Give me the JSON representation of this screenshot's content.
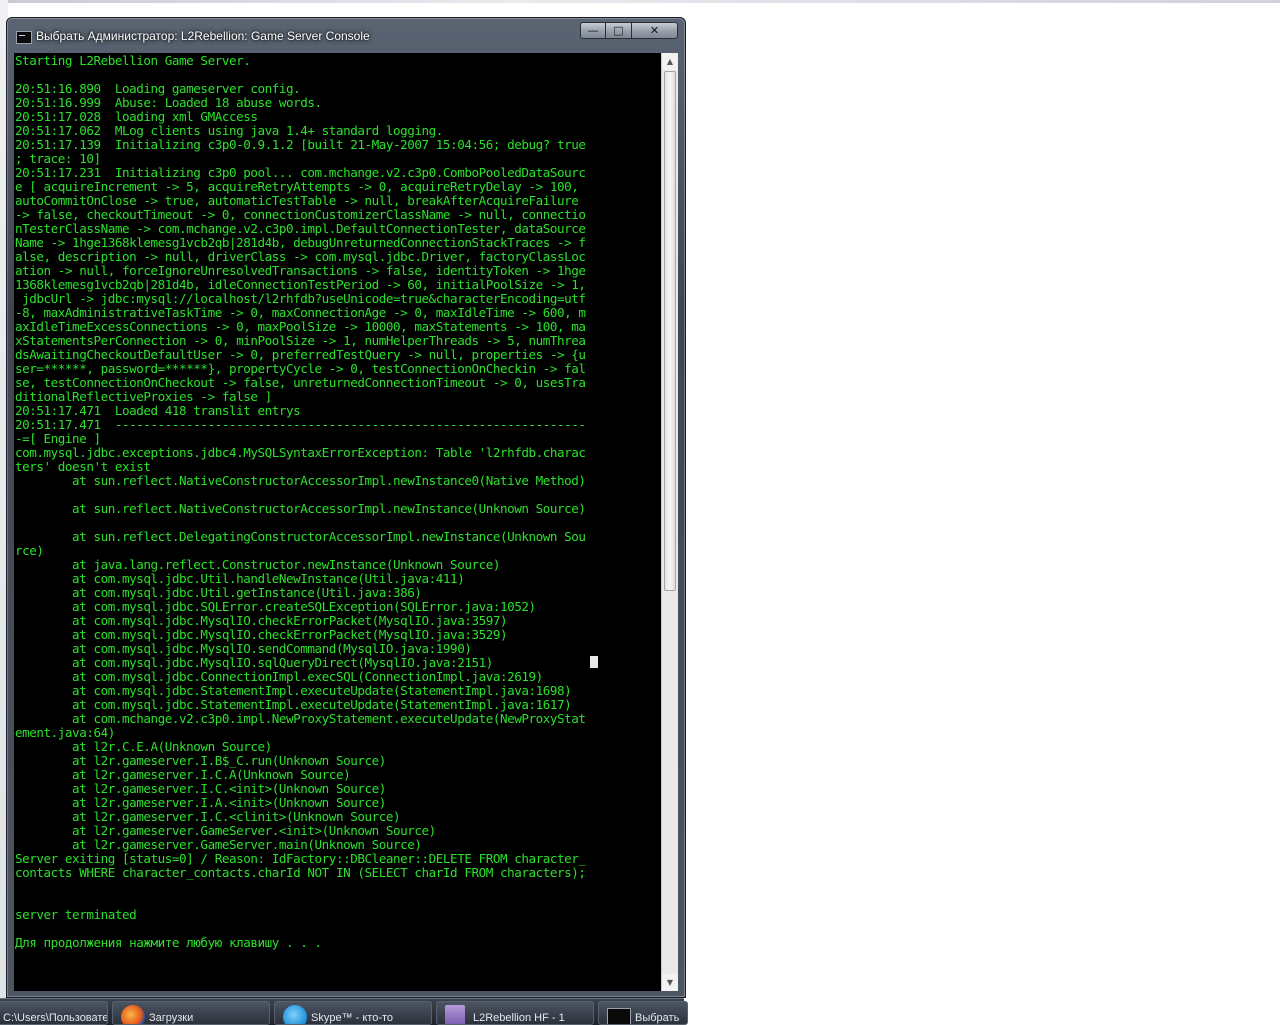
{
  "window": {
    "title": "Выбрать Администратор:  L2Rebellion: Game Server Console",
    "buttons": {
      "minimize": "—",
      "maximize": "□",
      "close": "✕"
    }
  },
  "console": {
    "lines": [
      "Starting L2Rebellion Game Server.",
      "",
      "20:51:16.890  Loading gameserver config.",
      "20:51:16.999  Abuse: Loaded 18 abuse words.",
      "20:51:17.028  loading xml GMAccess",
      "20:51:17.062  MLog clients using java 1.4+ standard logging.",
      "20:51:17.139  Initializing c3p0-0.9.1.2 [built 21-May-2007 15:04:56; debug? true",
      "; trace: 10]",
      "20:51:17.231  Initializing c3p0 pool... com.mchange.v2.c3p0.ComboPooledDataSourc",
      "e [ acquireIncrement -> 5, acquireRetryAttempts -> 0, acquireRetryDelay -> 100,",
      "autoCommitOnClose -> true, automaticTestTable -> null, breakAfterAcquireFailure",
      "-> false, checkoutTimeout -> 0, connectionCustomizerClassName -> null, connectio",
      "nTesterClassName -> com.mchange.v2.c3p0.impl.DefaultConnectionTester, dataSource",
      "Name -> 1hge1368klemesg1vcb2qb|281d4b, debugUnreturnedConnectionStackTraces -> f",
      "alse, description -> null, driverClass -> com.mysql.jdbc.Driver, factoryClassLoc",
      "ation -> null, forceIgnoreUnresolvedTransactions -> false, identityToken -> 1hge",
      "1368klemesg1vcb2qb|281d4b, idleConnectionTestPeriod -> 60, initialPoolSize -> 1,",
      " jdbcUrl -> jdbc:mysql://localhost/l2rhfdb?useUnicode=true&characterEncoding=utf",
      "-8, maxAdministrativeTaskTime -> 0, maxConnectionAge -> 0, maxIdleTime -> 600, m",
      "axIdleTimeExcessConnections -> 0, maxPoolSize -> 10000, maxStatements -> 100, ma",
      "xStatementsPerConnection -> 0, minPoolSize -> 1, numHelperThreads -> 5, numThrea",
      "dsAwaitingCheckoutDefaultUser -> 0, preferredTestQuery -> null, properties -> {u",
      "ser=******, password=******}, propertyCycle -> 0, testConnectionOnCheckin -> fal",
      "se, testConnectionOnCheckout -> false, unreturnedConnectionTimeout -> 0, usesTra",
      "ditionalReflectiveProxies -> false ]",
      "20:51:17.471  Loaded 418 translit entrys",
      "20:51:17.471  ------------------------------------------------------------------",
      "-=[ Engine ]",
      "com.mysql.jdbc.exceptions.jdbc4.MySQLSyntaxErrorException: Table 'l2rhfdb.charac",
      "ters' doesn't exist",
      "        at sun.reflect.NativeConstructorAccessorImpl.newInstance0(Native Method)",
      "",
      "        at sun.reflect.NativeConstructorAccessorImpl.newInstance(Unknown Source)",
      "",
      "        at sun.reflect.DelegatingConstructorAccessorImpl.newInstance(Unknown Sou",
      "rce)",
      "        at java.lang.reflect.Constructor.newInstance(Unknown Source)",
      "        at com.mysql.jdbc.Util.handleNewInstance(Util.java:411)",
      "        at com.mysql.jdbc.Util.getInstance(Util.java:386)",
      "        at com.mysql.jdbc.SQLError.createSQLException(SQLError.java:1052)",
      "        at com.mysql.jdbc.MysqlIO.checkErrorPacket(MysqlIO.java:3597)",
      "        at com.mysql.jdbc.MysqlIO.checkErrorPacket(MysqlIO.java:3529)",
      "        at com.mysql.jdbc.MysqlIO.sendCommand(MysqlIO.java:1990)",
      "        at com.mysql.jdbc.MysqlIO.sqlQueryDirect(MysqlIO.java:2151)",
      "        at com.mysql.jdbc.ConnectionImpl.execSQL(ConnectionImpl.java:2619)",
      "        at com.mysql.jdbc.StatementImpl.executeUpdate(StatementImpl.java:1698)",
      "        at com.mysql.jdbc.StatementImpl.executeUpdate(StatementImpl.java:1617)",
      "        at com.mchange.v2.c3p0.impl.NewProxyStatement.executeUpdate(NewProxyStat",
      "ement.java:64)",
      "        at l2r.C.E.A(Unknown Source)",
      "        at l2r.gameserver.I.B$_C.run(Unknown Source)",
      "        at l2r.gameserver.I.C.A(Unknown Source)",
      "        at l2r.gameserver.I.C.<init>(Unknown Source)",
      "        at l2r.gameserver.I.A.<init>(Unknown Source)",
      "        at l2r.gameserver.I.C.<clinit>(Unknown Source)",
      "        at l2r.gameserver.GameServer.<init>(Unknown Source)",
      "        at l2r.gameserver.GameServer.main(Unknown Source)",
      "Server exiting [status=0] / Reason: IdFactory::DBCleaner::DELETE FROM character_",
      "contacts WHERE character_contacts.charId NOT IN (SELECT charId FROM characters);",
      "",
      "",
      "server terminated",
      "",
      "Для продолжения нажмите любую клавишу . . ."
    ]
  },
  "taskbar": {
    "items": [
      {
        "label": "С:\\Users\\Пользователь",
        "icon": "folder-icon"
      },
      {
        "label": "Загрузки",
        "icon": "firefox-icon"
      },
      {
        "label": "Skype™ - кто-то",
        "icon": "skype-icon"
      },
      {
        "label": "L2Rebellion HF - 1",
        "icon": "winrar-icon"
      },
      {
        "label": "Выбрать",
        "icon": "cmd-icon"
      }
    ]
  },
  "colors": {
    "console_text": "#2ce02c",
    "console_bg": "#000000"
  }
}
